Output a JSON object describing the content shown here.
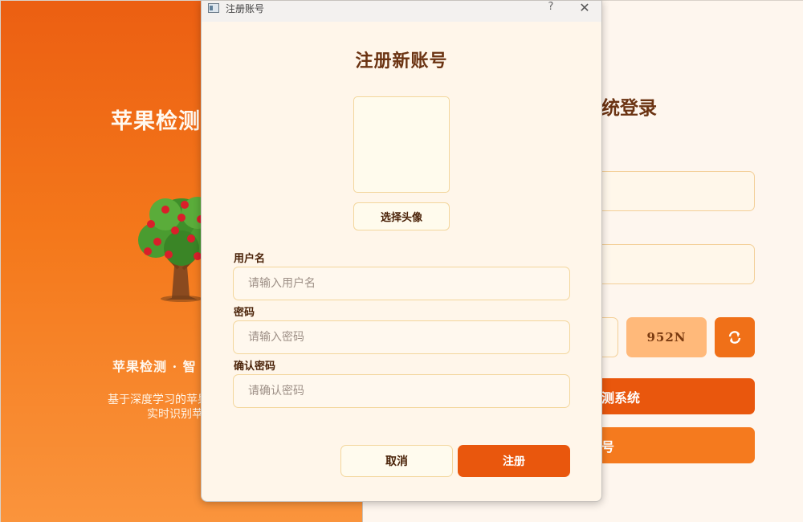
{
  "background": {
    "hero_title": "苹果检测",
    "slogan": "苹果检测  ·  智",
    "desc_line1": "基于深度学习的苹果",
    "desc_line2": "实时识别苹",
    "login_title": "统登录",
    "captcha_text": "952N",
    "login_button": "测系统",
    "register_button": "号",
    "accent": "#e9570d",
    "icons": [
      "apple-tree-icon",
      "refresh-icon"
    ]
  },
  "dialog": {
    "window_title": "注册账号",
    "help": "?",
    "heading": "注册新账号",
    "avatar_button": "选择头像",
    "username_label": "用户名",
    "username_placeholder": "请输入用户名",
    "password_label": "密码",
    "password_placeholder": "请输入密码",
    "confirm_label": "确认密码",
    "confirm_placeholder": "请确认密码",
    "cancel": "取消",
    "register": "注册"
  }
}
